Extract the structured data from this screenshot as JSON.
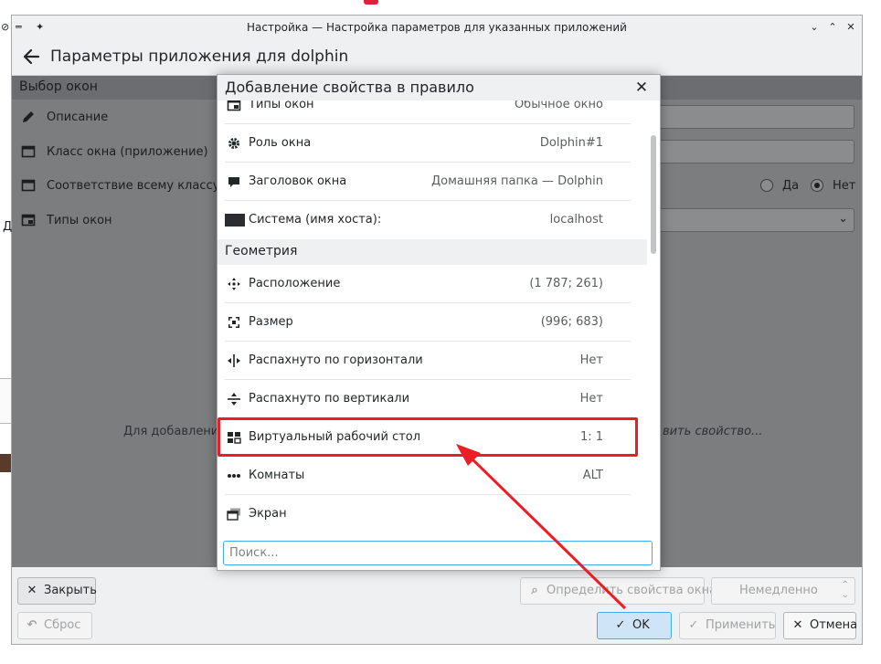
{
  "window": {
    "title": "Настройка — Настройка параметров для указанных приложений",
    "header_title": "Параметры приложения для dolphin"
  },
  "background": {
    "section_title": "Выбор окон",
    "rows": [
      {
        "label": "Описание"
      },
      {
        "label": "Класс окна (приложение)"
      },
      {
        "label": "Соответствие всему классу ок"
      },
      {
        "label": "Типы окон"
      }
    ],
    "radio_yes": "Да",
    "radio_no": "Нет",
    "hint_left": "Для добавления",
    "hint_right": "вить свойство...",
    "left_fragment": "Д"
  },
  "footer": {
    "close": "Закрыть",
    "reset": "Сброс",
    "detect": "Определить свойства окна",
    "immediately": "Немедленно",
    "ok": "OK",
    "apply": "Применить",
    "cancel": "Отмена"
  },
  "dialog": {
    "title": "Добавление свойства в правило",
    "rows_top": [
      {
        "label": "Типы окон",
        "value": "Обычное окно",
        "icon": "window-type-icon"
      },
      {
        "label": "Роль окна",
        "value": "Dolphin#1",
        "icon": "gear-icon"
      },
      {
        "label": "Заголовок окна",
        "value": "Домашняя папка — Dolphin",
        "icon": "speech-bubble-icon"
      },
      {
        "label": "Система (имя хоста):",
        "value": "localhost",
        "icon": "monitor-icon"
      }
    ],
    "group": "Геометрия",
    "rows_geometry": [
      {
        "label": "Расположение",
        "value": "(1 787; 261)",
        "icon": "move-icon"
      },
      {
        "label": "Размер",
        "value": "(996; 683)",
        "icon": "resize-icon"
      },
      {
        "label": "Распахнуто по горизонтали",
        "value": "Нет",
        "icon": "maximize-horizontal-icon"
      },
      {
        "label": "Распахнуто по вертикали",
        "value": "Нет",
        "icon": "maximize-vertical-icon"
      },
      {
        "label": "Виртуальный рабочий стол",
        "value": "1: 1",
        "icon": "virtual-desktop-icon"
      },
      {
        "label": "Комнаты",
        "value": "ALT",
        "icon": "activities-icon"
      },
      {
        "label": "Экран",
        "value": "",
        "icon": "screen-icon"
      }
    ],
    "search_placeholder": "Поиск..."
  },
  "colors": {
    "accent": "#3daee9",
    "annotation": "#ee1c24"
  }
}
